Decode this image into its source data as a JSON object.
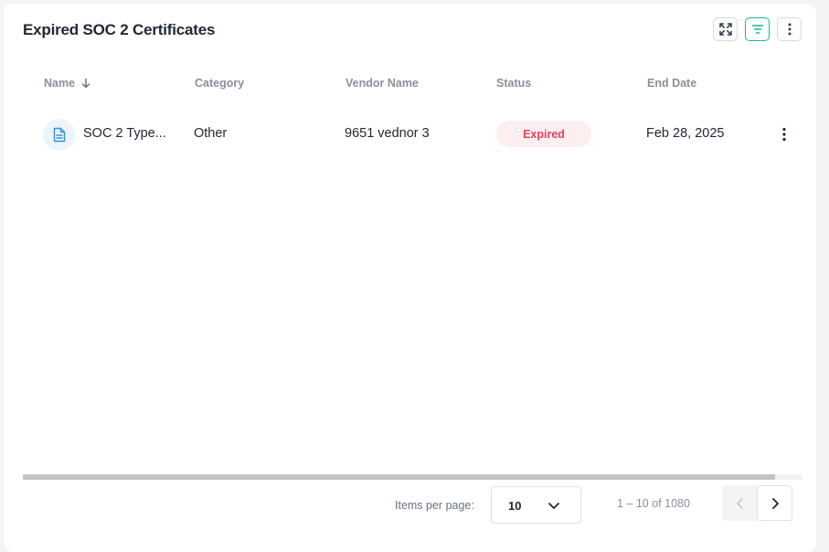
{
  "widget": {
    "title": "Expired SOC 2 Certificates",
    "toolbar": {
      "expand_icon": "expand-arrows-icon",
      "filter_icon": "filter-icon",
      "more_icon": "vertical-dots-icon",
      "accent_color": "#14b8a6"
    }
  },
  "table": {
    "columns": [
      {
        "label": "Name",
        "sort": "arrow-down-icon"
      },
      {
        "label": "Category"
      },
      {
        "label": "Vendor Name"
      },
      {
        "label": "Status"
      },
      {
        "label": "End Date"
      }
    ],
    "rows": [
      {
        "icon": "document-icon",
        "name": "SOC 2 Type...",
        "category": "Other",
        "vendor": "9651 vednor 3",
        "status": "Expired",
        "status_color": "#e04462",
        "end_date": "Feb 28, 2025"
      }
    ]
  },
  "pagination": {
    "items_per_page_label": "Items per page:",
    "items_per_page": "10",
    "range": "1 – 10 of 1080"
  }
}
